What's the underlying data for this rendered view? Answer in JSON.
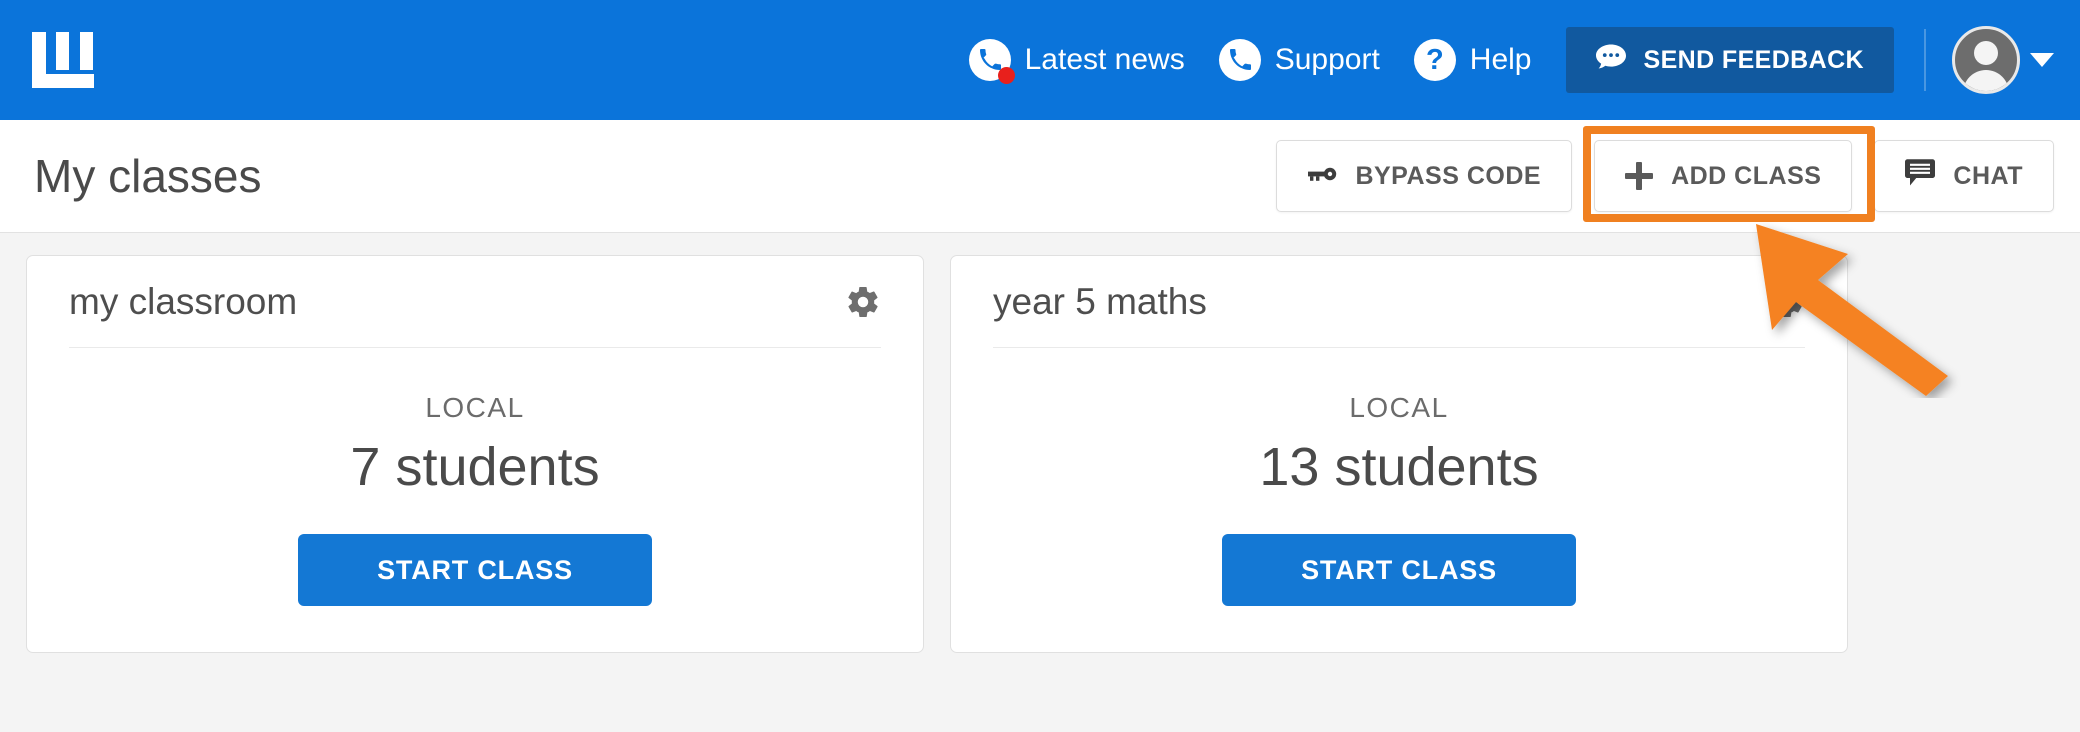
{
  "colors": {
    "header_blue": "#0b74da",
    "feedback_blue": "#11599f",
    "primary_button_blue": "#1478d4",
    "highlight_orange": "#f08020",
    "badge_red": "#e8201c",
    "content_bg": "#f4f4f4"
  },
  "header": {
    "logo_name": "lanschool-logo",
    "nav": [
      {
        "label": "Latest news",
        "icon": "phone-icon",
        "badge": true
      },
      {
        "label": "Support",
        "icon": "phone-icon",
        "badge": false
      },
      {
        "label": "Help",
        "icon": "question-mark-icon",
        "badge": false
      }
    ],
    "feedback_button": {
      "label": "SEND FEEDBACK",
      "icon": "chat-bubble-icon"
    },
    "account": {
      "icon": "avatar-icon",
      "caret": "chevron-down-icon"
    }
  },
  "toolbar": {
    "title": "My classes",
    "buttons": [
      {
        "label": "BYPASS CODE",
        "icon": "key-icon",
        "highlighted": false
      },
      {
        "label": "ADD CLASS",
        "icon": "plus-icon",
        "highlighted": true
      },
      {
        "label": "CHAT",
        "icon": "chat-bubble-icon",
        "highlighted": false
      }
    ]
  },
  "annotation": {
    "type": "arrow",
    "color": "#f08020",
    "points_to": "ADD CLASS",
    "highlight_target": "ADD CLASS"
  },
  "classes": [
    {
      "name": "my classroom",
      "scope_label": "LOCAL",
      "students_text": "7 students",
      "student_count": 7,
      "start_label": "START CLASS",
      "settings_icon": "gear-icon"
    },
    {
      "name": "year 5 maths",
      "scope_label": "LOCAL",
      "students_text": "13 students",
      "student_count": 13,
      "start_label": "START CLASS",
      "settings_icon": "gear-icon"
    }
  ]
}
